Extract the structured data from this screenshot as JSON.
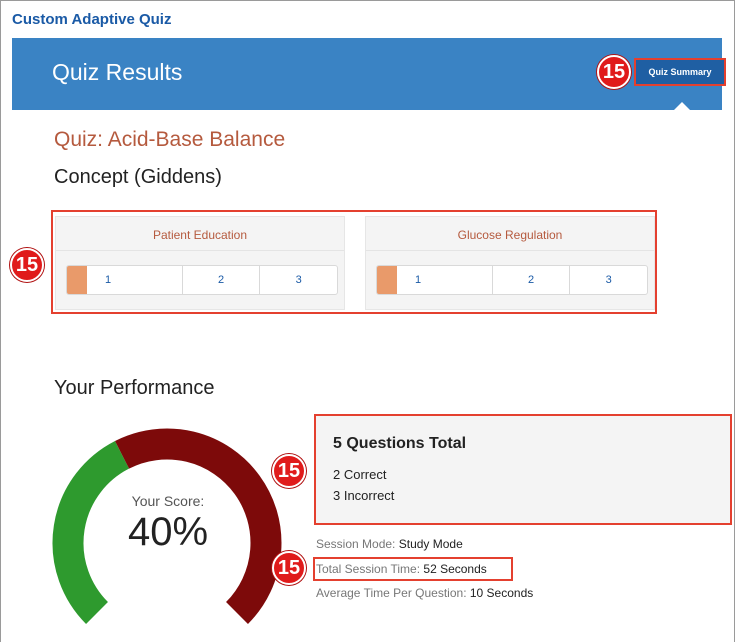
{
  "app": {
    "title": "Custom Adaptive Quiz"
  },
  "header": {
    "title": "Quiz Results",
    "summary_button": "Quiz Summary"
  },
  "annotation": {
    "badge_number": "15"
  },
  "quiz": {
    "title": "Quiz: Acid-Base Balance",
    "concept_heading": "Concept (Giddens)"
  },
  "concepts": [
    {
      "label": "Patient Education",
      "questions": [
        "1",
        "2",
        "3"
      ]
    },
    {
      "label": "Glucose Regulation",
      "questions": [
        "1",
        "2",
        "3"
      ]
    }
  ],
  "performance": {
    "heading": "Your Performance",
    "score_label": "Your Score:",
    "score_value": "40%",
    "score_fraction": 0.4,
    "colors": {
      "correct": "#2e9a2e",
      "incorrect": "#7d0a0a",
      "marker": "#e99a6a",
      "header": "#3a83c4",
      "highlight": "#e4402f"
    },
    "totals_title": "5 Questions Total",
    "correct_text": "2 Correct",
    "incorrect_text": "3 Incorrect"
  },
  "session": {
    "mode_label": "Session Mode:",
    "mode_value": "Study Mode",
    "time_label": "Total Session Time:",
    "time_value": "52 Seconds",
    "avg_label": "Average Time Per Question:",
    "avg_value": "10 Seconds"
  }
}
